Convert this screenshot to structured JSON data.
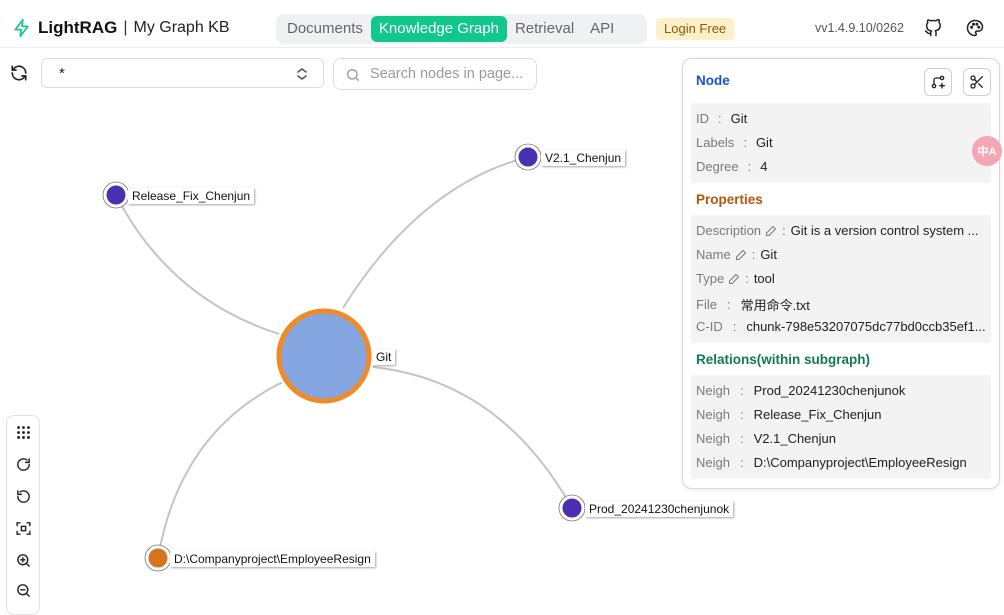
{
  "header": {
    "brand_name": "LightRAG",
    "brand_sep": "|",
    "kb_name": "My Graph KB",
    "tabs": [
      {
        "label": "Documents"
      },
      {
        "label": "Knowledge Graph"
      },
      {
        "label": "Retrieval"
      },
      {
        "label": "API"
      }
    ],
    "login_label": "Login Free",
    "version": "vv1.4.9.10/0262"
  },
  "toolbar": {
    "label_select_value": "*",
    "search_placeholder": "Search nodes in page..."
  },
  "graph": {
    "nodes": [
      {
        "id": "Git",
        "label": "Git"
      },
      {
        "id": "V2.1_Chenjun",
        "label": "V2.1_Chenjun"
      },
      {
        "id": "Release_Fix_Chenjun",
        "label": "Release_Fix_Chenjun"
      },
      {
        "id": "Prod_20241230chenjunok",
        "label": "Prod_20241230chenjunok"
      },
      {
        "id": "D:\\Companyproject\\EmployeeResign",
        "label": "D:\\Companyproject\\EmployeeResign"
      }
    ],
    "colors": {
      "center_fill": "#84a5e0",
      "center_ring": "#f08a24",
      "entity": "#4a2fb0",
      "file": "#d8721c",
      "edge": "#c4c4c4"
    }
  },
  "panel": {
    "title": "Node",
    "node": {
      "id_label": "ID",
      "id_value": "Git",
      "labels_label": "Labels",
      "labels_value": "Git",
      "degree_label": "Degree",
      "degree_value": "4"
    },
    "properties_title": "Properties",
    "properties": {
      "description_label": "Description",
      "description_value": "Git is a version control system ...",
      "name_label": "Name",
      "name_value": "Git",
      "type_label": "Type",
      "type_value": "tool",
      "file_label": "File",
      "file_value": "常用命令.txt",
      "cid_label": "C-ID",
      "cid_value": "chunk-798e53207075dc77bd0ccb35ef1..."
    },
    "relations_title": "Relations(within subgraph)",
    "relations": [
      {
        "label": "Neigh",
        "value": "Prod_20241230chenjunok"
      },
      {
        "label": "Neigh",
        "value": "Release_Fix_Chenjun"
      },
      {
        "label": "Neigh",
        "value": "V2.1_Chenjun"
      },
      {
        "label": "Neigh",
        "value": "D:\\Companyproject\\EmployeeResign"
      }
    ],
    "colors": {
      "node_title": "#1b4fd6",
      "properties_title": "#b5540c",
      "relations_title": "#107a52"
    }
  },
  "translate_fab_label": "中A"
}
